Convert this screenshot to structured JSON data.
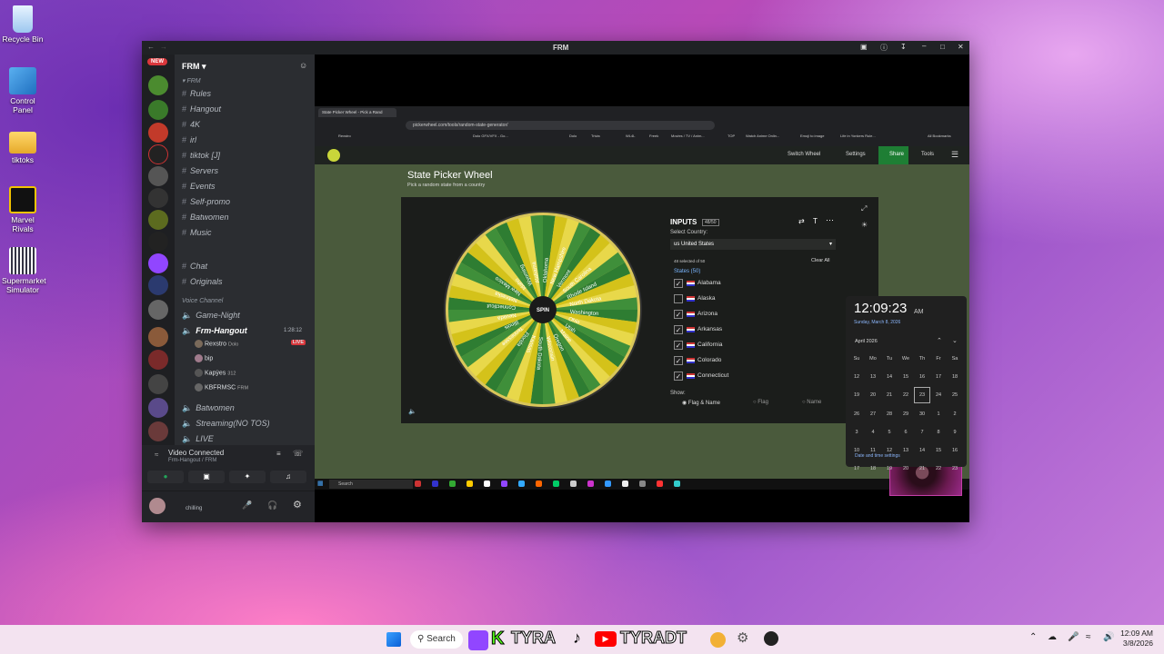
{
  "desktop": {
    "icons": [
      {
        "label": "Recycle Bin"
      },
      {
        "label": "Control Panel"
      },
      {
        "label": "tiktoks"
      },
      {
        "label": "Marvel Rivals"
      },
      {
        "label": "Supermarket Simulator"
      }
    ]
  },
  "window": {
    "title": "FRM"
  },
  "discord": {
    "server_name": "FRM",
    "new_badge": "NEW",
    "category": "FRM",
    "channels": [
      "Rules",
      "Hangout",
      "4K",
      "irl",
      "tiktok [J]",
      "Servers",
      "Events",
      "Self-promo",
      "Batwomen",
      "Music",
      "Chat",
      "Originals"
    ],
    "voice_category": "Voice Channel",
    "voice_channels": [
      {
        "name": "Game-Night"
      },
      {
        "name": "Frm-Hangout",
        "timer": "1:28:12"
      },
      {
        "name": "Batwomen"
      },
      {
        "name": "Streaming(NO TOS)"
      },
      {
        "name": "LIVE"
      }
    ],
    "voice_users": [
      {
        "name": "Rexstro",
        "game": "Dolo",
        "live": "LIVE"
      },
      {
        "name": "bip"
      },
      {
        "name": "Kapÿes",
        "game": "312"
      },
      {
        "name": "KBFRMSC",
        "game": "FRM"
      }
    ],
    "vc_status": "Video Connected",
    "vc_sub": "Frm-Hangout / FRM",
    "user_status": "chilling"
  },
  "browser": {
    "tab": "State Picker Wheel - Pick a Rand",
    "url": "pickerwheel.com/tools/random-state-generator/",
    "bookmarks": [
      "Rexstro",
      "Dolo GFX/VFX - Go...",
      "Dolo",
      "Trivia",
      "WL4L",
      "Freek",
      "Movies / TV / Anim...",
      "TOP",
      "Watch Anime Onlin...",
      "Emoji to image",
      "Life in Yonkers Rule...",
      "All Bookmarks"
    ],
    "nav": {
      "switch": "Switch Wheel",
      "settings": "Settings",
      "share": "Share",
      "tools": "Tools"
    }
  },
  "picker": {
    "title": "State Picker Wheel",
    "subtitle": "Pick a random state from a country",
    "spin": "SPIN",
    "inputs_label": "INPUTS",
    "inputs_count": "48/50",
    "country_label": "Select Country:",
    "country": "us United States",
    "selected": "48 selected of 50",
    "clear": "Clear All",
    "states_header": "States (50)",
    "states": [
      {
        "name": "Alabama",
        "checked": true
      },
      {
        "name": "Alaska",
        "checked": false
      },
      {
        "name": "Arizona",
        "checked": true
      },
      {
        "name": "Arkansas",
        "checked": true
      },
      {
        "name": "California",
        "checked": true
      },
      {
        "name": "Colorado",
        "checked": true
      },
      {
        "name": "Connecticut",
        "checked": true
      }
    ],
    "show_label": "Show:",
    "show_options": [
      "Flag & Name",
      "Flag",
      "Name"
    ],
    "wheel_labels": [
      "Oklahoma",
      "New Hampshire",
      "Vermont",
      "South Carolina",
      "Rhode Island",
      "North Dakota",
      "Washington",
      "Ohio",
      "Utah",
      "Maine",
      "Oregon",
      "Wisconsin",
      "South Dakota",
      "Kansas",
      "Florida",
      "Tennessee",
      "Illinois",
      "Nevada",
      "Connecticut",
      "Nebraska",
      "New Mexico",
      "Idaho",
      "Wyoming",
      "Alabama"
    ]
  },
  "clock": {
    "time": "12:09:23",
    "ampm": "AM",
    "date": "Sunday, March 8, 2026",
    "month": "April 2026",
    "days": [
      "Su",
      "Mo",
      "Tu",
      "We",
      "Th",
      "Fr",
      "Sa"
    ],
    "weeks": [
      [
        "12",
        "13",
        "14",
        "15",
        "16",
        "17",
        "18"
      ],
      [
        "19",
        "20",
        "21",
        "22",
        "23",
        "24",
        "25"
      ],
      [
        "26",
        "27",
        "28",
        "29",
        "30",
        "1",
        "2"
      ],
      [
        "3",
        "4",
        "5",
        "6",
        "7",
        "8",
        "9"
      ],
      [
        "10",
        "11",
        "12",
        "13",
        "14",
        "15",
        "16"
      ],
      [
        "17",
        "18",
        "19",
        "20",
        "21",
        "22",
        "23"
      ]
    ],
    "footer": "Date and time settings"
  },
  "inner_taskbar": {
    "search": "Search"
  },
  "taskbar": {
    "search": "Search",
    "brand1": "TYRA",
    "brand2": "TYRADT",
    "time": "12:09 AM",
    "date": "3/8/2026"
  },
  "colors": {
    "wheel_green": "#2e7d32",
    "wheel_yellow": "#d4c21a",
    "share_green": "#1e7e34",
    "discord_bg": "#2b2d31"
  }
}
